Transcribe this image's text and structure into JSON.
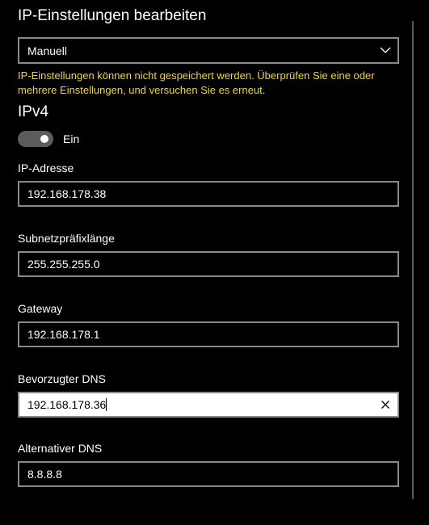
{
  "header": {
    "title": "IP-Einstellungen bearbeiten"
  },
  "mode_select": {
    "value": "Manuell",
    "icon": "chevron-down-icon"
  },
  "warning": {
    "text": "IP-Einstellungen können nicht gespeichert werden. Überprüfen Sie eine oder mehrere Einstellungen, und versuchen Sie es erneut.",
    "color": "#f3d53a"
  },
  "ipv4": {
    "section_title": "IPv4",
    "toggle": {
      "state_label": "Ein",
      "on": true
    },
    "fields": {
      "ip_address": {
        "label": "IP-Adresse",
        "value": "192.168.178.38"
      },
      "subnet_prefix": {
        "label": "Subnetzpräfixlänge",
        "value": "255.255.255.0"
      },
      "gateway": {
        "label": "Gateway",
        "value": "192.168.178.1"
      },
      "preferred_dns": {
        "label": "Bevorzugter DNS",
        "value": "192.168.178.36",
        "focused": true,
        "clear_icon": "close-icon"
      },
      "alternate_dns": {
        "label": "Alternativer DNS",
        "value": "8.8.8.8"
      }
    }
  }
}
